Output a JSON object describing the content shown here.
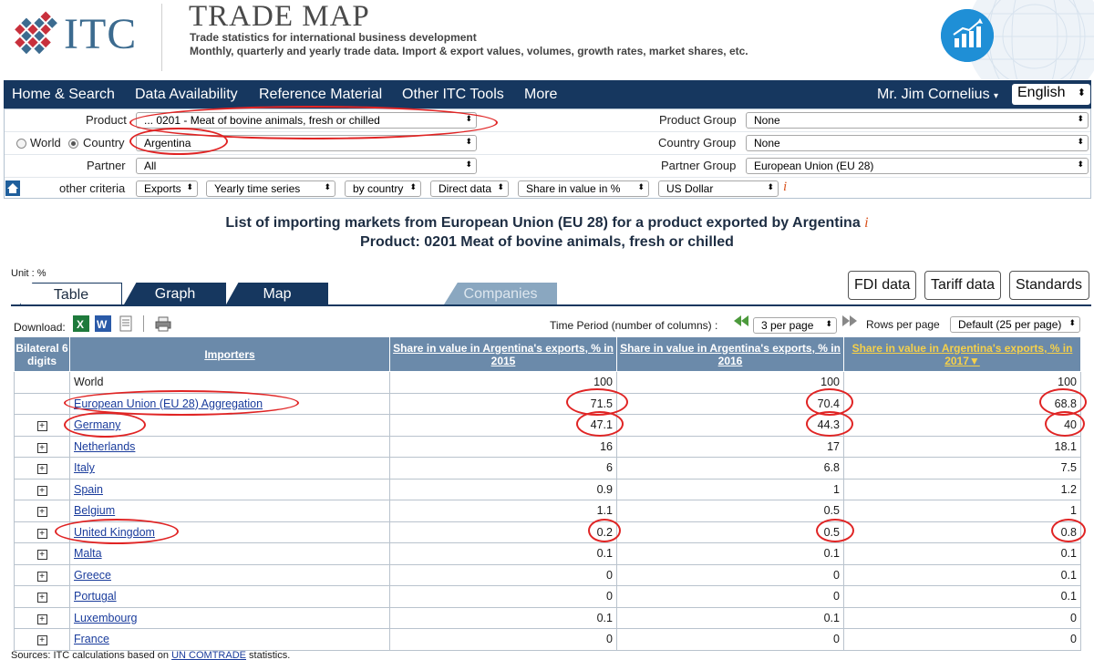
{
  "header": {
    "logo_text": "ITC",
    "title": "TRADE MAP",
    "subtitle_line1": "Trade statistics for international business development",
    "subtitle_line2": "Monthly, quarterly and yearly trade data. Import & export values, volumes, growth rates, market shares, etc."
  },
  "nav": {
    "items": [
      "Home & Search",
      "Data Availability",
      "Reference Material",
      "Other ITC Tools",
      "More"
    ],
    "user": "Mr. Jim Cornelius",
    "language": "English"
  },
  "criteria": {
    "product_label": "Product",
    "product_value": "... 0201 - Meat of bovine animals, fresh or chilled",
    "world_label": "World",
    "country_label": "Country",
    "country_value": "Argentina",
    "partner_label": "Partner",
    "partner_value": "All",
    "product_group_label": "Product Group",
    "product_group_value": "None",
    "country_group_label": "Country Group",
    "country_group_value": "None",
    "partner_group_label": "Partner Group",
    "partner_group_value": "European Union (EU 28)",
    "other_criteria_label": "other criteria",
    "flow": "Exports",
    "series": "Yearly time series",
    "by": "by country",
    "data_type": "Direct data",
    "indicator": "Share in value in %",
    "currency": "US Dollar",
    "info_icon": "i"
  },
  "titles": {
    "main": "List of importing markets from European Union (EU 28) for a product exported by Argentina",
    "product": "Product: 0201 Meat of bovine animals, fresh or chilled",
    "info_icon": "i"
  },
  "unit": "Unit : %",
  "tabs": [
    "Table",
    "Graph",
    "Map",
    "Companies"
  ],
  "buttons": {
    "fdi": "FDI data",
    "tariff": "Tariff data",
    "standards": "Standards"
  },
  "toolbar": {
    "download_label": "Download:",
    "time_period_label": "Time Period (number of columns) :",
    "per_page": "3 per page",
    "rows_per_page_label": "Rows per page",
    "rows_per_page": "Default (25 per page)"
  },
  "table": {
    "col_bilateral": "Bilateral 6 digits",
    "col_importers": "Importers",
    "col_2015": "Share in value in Argentina's exports, % in 2015",
    "col_2016": "Share in value in Argentina's exports, % in 2016",
    "col_2017": "Share in value in Argentina's exports, % in 2017",
    "sort_icon": "▼",
    "rows": [
      {
        "name": "World",
        "link": false,
        "expand": false,
        "v2015": "100",
        "v2016": "100",
        "v2017": "100"
      },
      {
        "name": "European Union (EU 28) Aggregation",
        "link": true,
        "expand": false,
        "v2015": "71.5",
        "v2016": "70.4",
        "v2017": "68.8"
      },
      {
        "name": "Germany",
        "link": true,
        "expand": true,
        "v2015": "47.1",
        "v2016": "44.3",
        "v2017": "40"
      },
      {
        "name": "Netherlands",
        "link": true,
        "expand": true,
        "v2015": "16",
        "v2016": "17",
        "v2017": "18.1"
      },
      {
        "name": "Italy",
        "link": true,
        "expand": true,
        "v2015": "6",
        "v2016": "6.8",
        "v2017": "7.5"
      },
      {
        "name": "Spain",
        "link": true,
        "expand": true,
        "v2015": "0.9",
        "v2016": "1",
        "v2017": "1.2"
      },
      {
        "name": "Belgium",
        "link": true,
        "expand": true,
        "v2015": "1.1",
        "v2016": "0.5",
        "v2017": "1"
      },
      {
        "name": "United Kingdom",
        "link": true,
        "expand": true,
        "v2015": "0.2",
        "v2016": "0.5",
        "v2017": "0.8"
      },
      {
        "name": "Malta",
        "link": true,
        "expand": true,
        "v2015": "0.1",
        "v2016": "0.1",
        "v2017": "0.1"
      },
      {
        "name": "Greece",
        "link": true,
        "expand": true,
        "v2015": "0",
        "v2016": "0",
        "v2017": "0.1"
      },
      {
        "name": "Portugal",
        "link": true,
        "expand": true,
        "v2015": "0",
        "v2016": "0",
        "v2017": "0.1"
      },
      {
        "name": "Luxembourg",
        "link": true,
        "expand": true,
        "v2015": "0.1",
        "v2016": "0.1",
        "v2017": "0"
      },
      {
        "name": "France",
        "link": true,
        "expand": true,
        "v2015": "0",
        "v2016": "0",
        "v2017": "0"
      }
    ]
  },
  "sources": {
    "prefix": "Sources: ITC calculations based on ",
    "link": "UN COMTRADE",
    "suffix": " statistics."
  },
  "colors": {
    "nav": "#16375f",
    "header_cell": "#6b8aaa",
    "annotation": "#e02424",
    "active_sort": "#f5d04a"
  }
}
